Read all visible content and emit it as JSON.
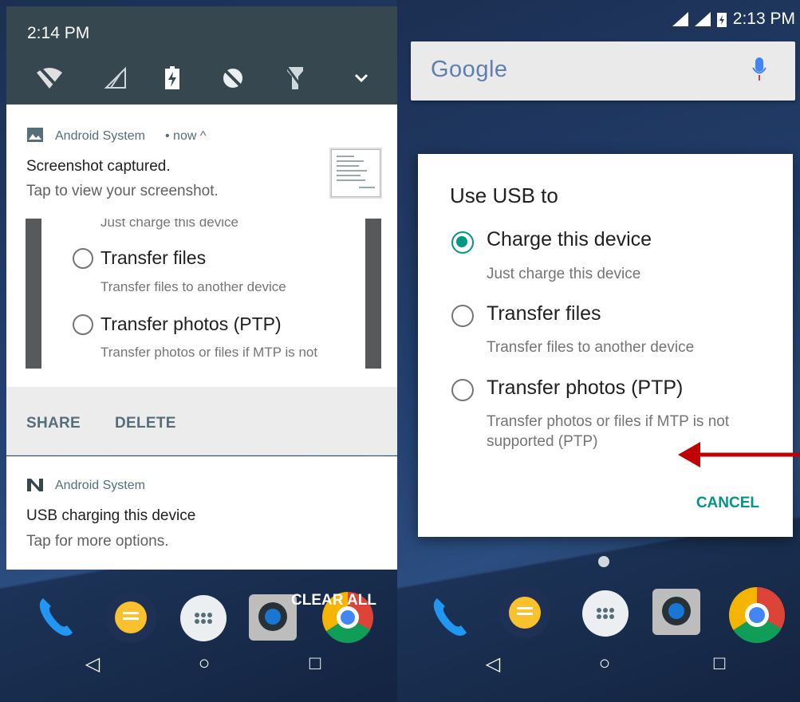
{
  "left": {
    "time": "2:14 PM",
    "quick_settings_icons": [
      "wifi-off-icon",
      "signal-icon",
      "battery-charging-icon",
      "data-saver-icon",
      "flashlight-off-icon",
      "chevron-down-icon"
    ],
    "notification1": {
      "app": "Android System",
      "meta": "• now ^",
      "title": "Screenshot captured.",
      "text": "Tap to view your screenshot.",
      "preview": {
        "line0": "Just charge this device",
        "opt1": "Transfer files",
        "opt1_sub": "Transfer files to another device",
        "opt2": "Transfer photos (PTP)",
        "opt2_sub": "Transfer photos or files if MTP is not"
      },
      "actions": [
        "SHARE",
        "DELETE"
      ]
    },
    "notification2": {
      "app": "Android System",
      "title": "USB charging this device",
      "text": "Tap for more options."
    },
    "clear_all": "CLEAR ALL"
  },
  "right": {
    "time": "2:13 PM",
    "search_brand": "Google",
    "dialog": {
      "title": "Use USB to",
      "options": [
        {
          "label": "Charge this device",
          "sub": "Just charge this device",
          "selected": true
        },
        {
          "label": "Transfer files",
          "sub": "Transfer files to another device",
          "selected": false
        },
        {
          "label": "Transfer photos (PTP)",
          "sub1": "Transfer photos or files if MTP is not",
          "sub2": "supported (PTP)",
          "selected": false
        }
      ],
      "cancel": "CANCEL"
    }
  },
  "nav": {
    "back": "◁",
    "home": "○",
    "recents": "□"
  },
  "colors": {
    "accent": "#009688",
    "shade": "#37474f",
    "annotation_arrow": "#c00000"
  }
}
